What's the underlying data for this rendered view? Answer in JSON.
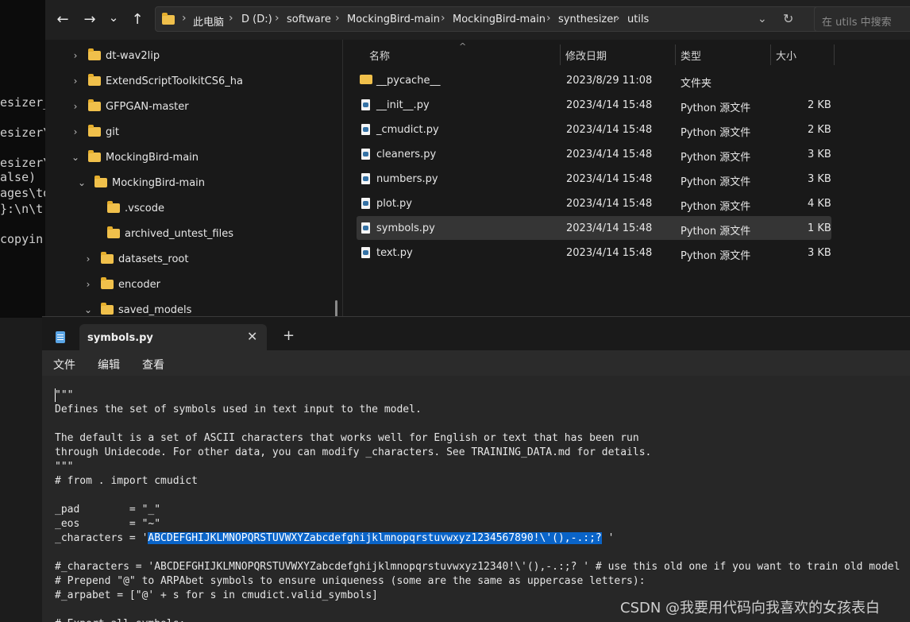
{
  "terminal": {
    "lines": [
      "esizer_",
      "esizer\\",
      "esizer\\",
      "alse)",
      "ages\\to",
      "}:\\n\\t",
      "copyin"
    ]
  },
  "nav": {
    "back_icon": "←",
    "forward_icon": "→",
    "recent_icon": "⌄",
    "up_icon": "↑",
    "refresh_icon": "↻",
    "dropdown_icon": "⌄"
  },
  "breadcrumb": [
    "此电脑",
    "D (D:)",
    "software",
    "MockingBird-main",
    "MockingBird-main",
    "synthesizer",
    "utils"
  ],
  "breadcrumb_sep": "›",
  "search": {
    "placeholder": "在 utils 中搜索"
  },
  "tree": [
    {
      "label": "dt-wav2lip",
      "chev": "›"
    },
    {
      "label": "ExtendScriptToolkitCS6_ha",
      "chev": "›"
    },
    {
      "label": "GFPGAN-master",
      "chev": "›"
    },
    {
      "label": "git",
      "chev": "›"
    },
    {
      "label": "MockingBird-main",
      "chev": "⌄"
    },
    {
      "label": "MockingBird-main",
      "chev": "⌄"
    },
    {
      "label": ".vscode",
      "chev": ""
    },
    {
      "label": "archived_untest_files",
      "chev": ""
    },
    {
      "label": "datasets_root",
      "chev": "›"
    },
    {
      "label": "encoder",
      "chev": "›"
    },
    {
      "label": "saved_models",
      "chev": "⌄"
    }
  ],
  "columns": {
    "name": "名称",
    "date": "修改日期",
    "type": "类型",
    "size": "大小",
    "sort_icon": "^"
  },
  "files": [
    {
      "name": "__pycache__",
      "date": "2023/8/29 11:08",
      "type": "文件夹",
      "size": "",
      "kind": "folder"
    },
    {
      "name": "__init__.py",
      "date": "2023/4/14 15:48",
      "type": "Python 源文件",
      "size": "2 KB",
      "kind": "py"
    },
    {
      "name": "_cmudict.py",
      "date": "2023/4/14 15:48",
      "type": "Python 源文件",
      "size": "2 KB",
      "kind": "py"
    },
    {
      "name": "cleaners.py",
      "date": "2023/4/14 15:48",
      "type": "Python 源文件",
      "size": "3 KB",
      "kind": "py"
    },
    {
      "name": "numbers.py",
      "date": "2023/4/14 15:48",
      "type": "Python 源文件",
      "size": "3 KB",
      "kind": "py"
    },
    {
      "name": "plot.py",
      "date": "2023/4/14 15:48",
      "type": "Python 源文件",
      "size": "4 KB",
      "kind": "py"
    },
    {
      "name": "symbols.py",
      "date": "2023/4/14 15:48",
      "type": "Python 源文件",
      "size": "1 KB",
      "kind": "py",
      "selected": true
    },
    {
      "name": "text.py",
      "date": "2023/4/14 15:48",
      "type": "Python 源文件",
      "size": "3 KB",
      "kind": "py"
    }
  ],
  "notepad": {
    "tab_title": "symbols.py",
    "close_icon": "✕",
    "new_tab_icon": "+",
    "menu": [
      "文件",
      "编辑",
      "查看"
    ],
    "code": [
      "\"\"\"",
      "Defines the set of symbols used in text input to the model.",
      "",
      "The default is a set of ASCII characters that works well for English or text that has been run",
      "through Unidecode. For other data, you can modify _characters. See TRAINING_DATA.md for details.",
      "\"\"\"",
      "# from . import cmudict",
      "",
      "_pad        = \"_\"",
      "_eos        = \"~\"",
      "_characters = '",
      "",
      "#_characters = 'ABCDEFGHIJKLMNOPQRSTUVWXYZabcdefghijklmnopqrstuvwxyz12340!\\'(),-.:;? ' # use this old one if you want to train old model",
      "# Prepend \"@\" to ARPAbet symbols to ensure uniqueness (some are the same as uppercase letters):",
      "#_arpabet = [\"@' + s for s in cmudict.valid_symbols]",
      "",
      "# Export all symbols:"
    ],
    "highlight_text": "ABCDEFGHIJKLMNOPQRSTUVWXYZabcdefghijklmnopqrstuvwxyz1234567890!\\'(),-.:;?",
    "highlight_tail": " '"
  },
  "watermark": "CSDN @我要用代码向我喜欢的女孩表白",
  "colors": {
    "folder": "#f0c04b",
    "selection": "#0a64c8",
    "python": "#3572a5"
  }
}
